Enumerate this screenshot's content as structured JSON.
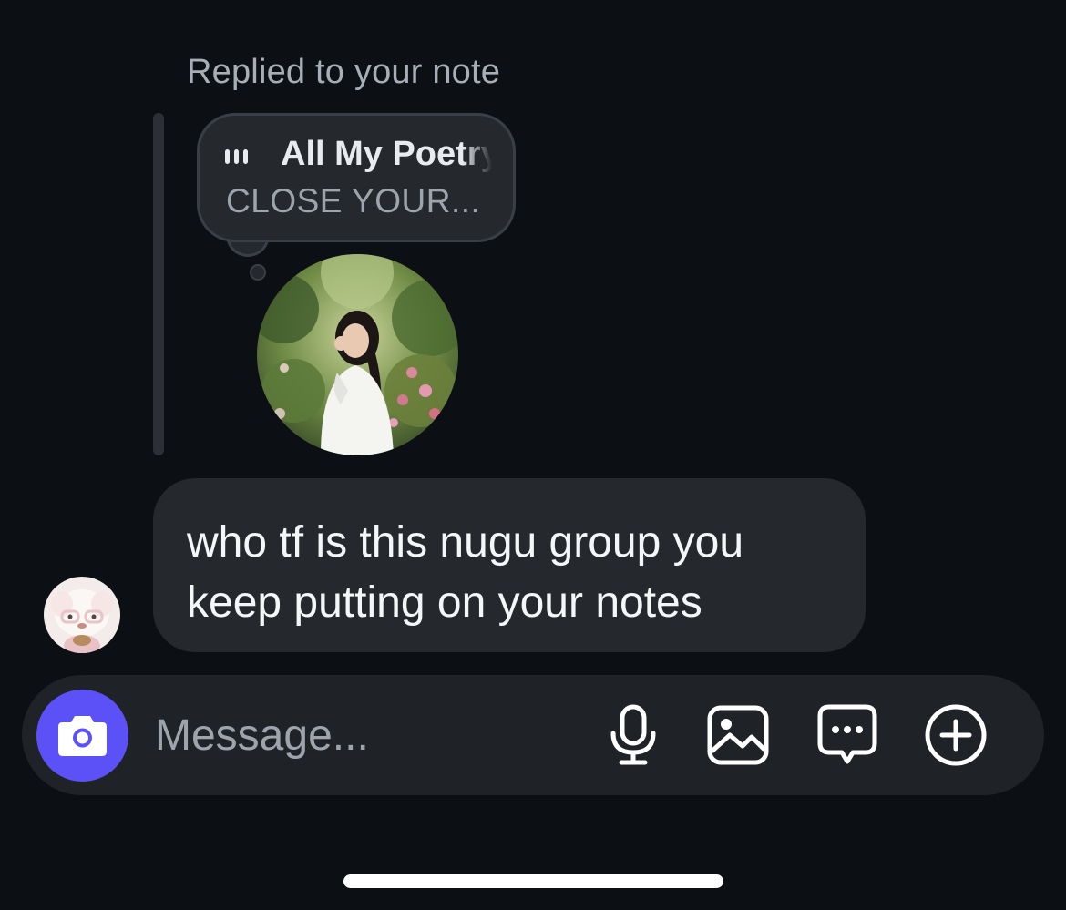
{
  "reply_context": {
    "label": "Replied to your note"
  },
  "note": {
    "song_title": "All My Poetry",
    "song_artist": "CLOSE YOUR...",
    "music_icon": "audio-bars-icon"
  },
  "message": {
    "text": "who tf is this nugu group you\nkeep putting on your notes"
  },
  "composer": {
    "placeholder": "Message...",
    "value": "",
    "camera_icon": "camera-icon",
    "actions": [
      {
        "name": "microphone-icon"
      },
      {
        "name": "gallery-icon"
      },
      {
        "name": "sticker-chat-icon"
      },
      {
        "name": "plus-circle-icon"
      }
    ]
  },
  "colors": {
    "background": "#0c1014",
    "bubble": "#25292e",
    "composer": "#1f2328",
    "accent": "#5b51f6",
    "text_primary": "#f5f6f7",
    "text_secondary": "#9ea4ab"
  }
}
